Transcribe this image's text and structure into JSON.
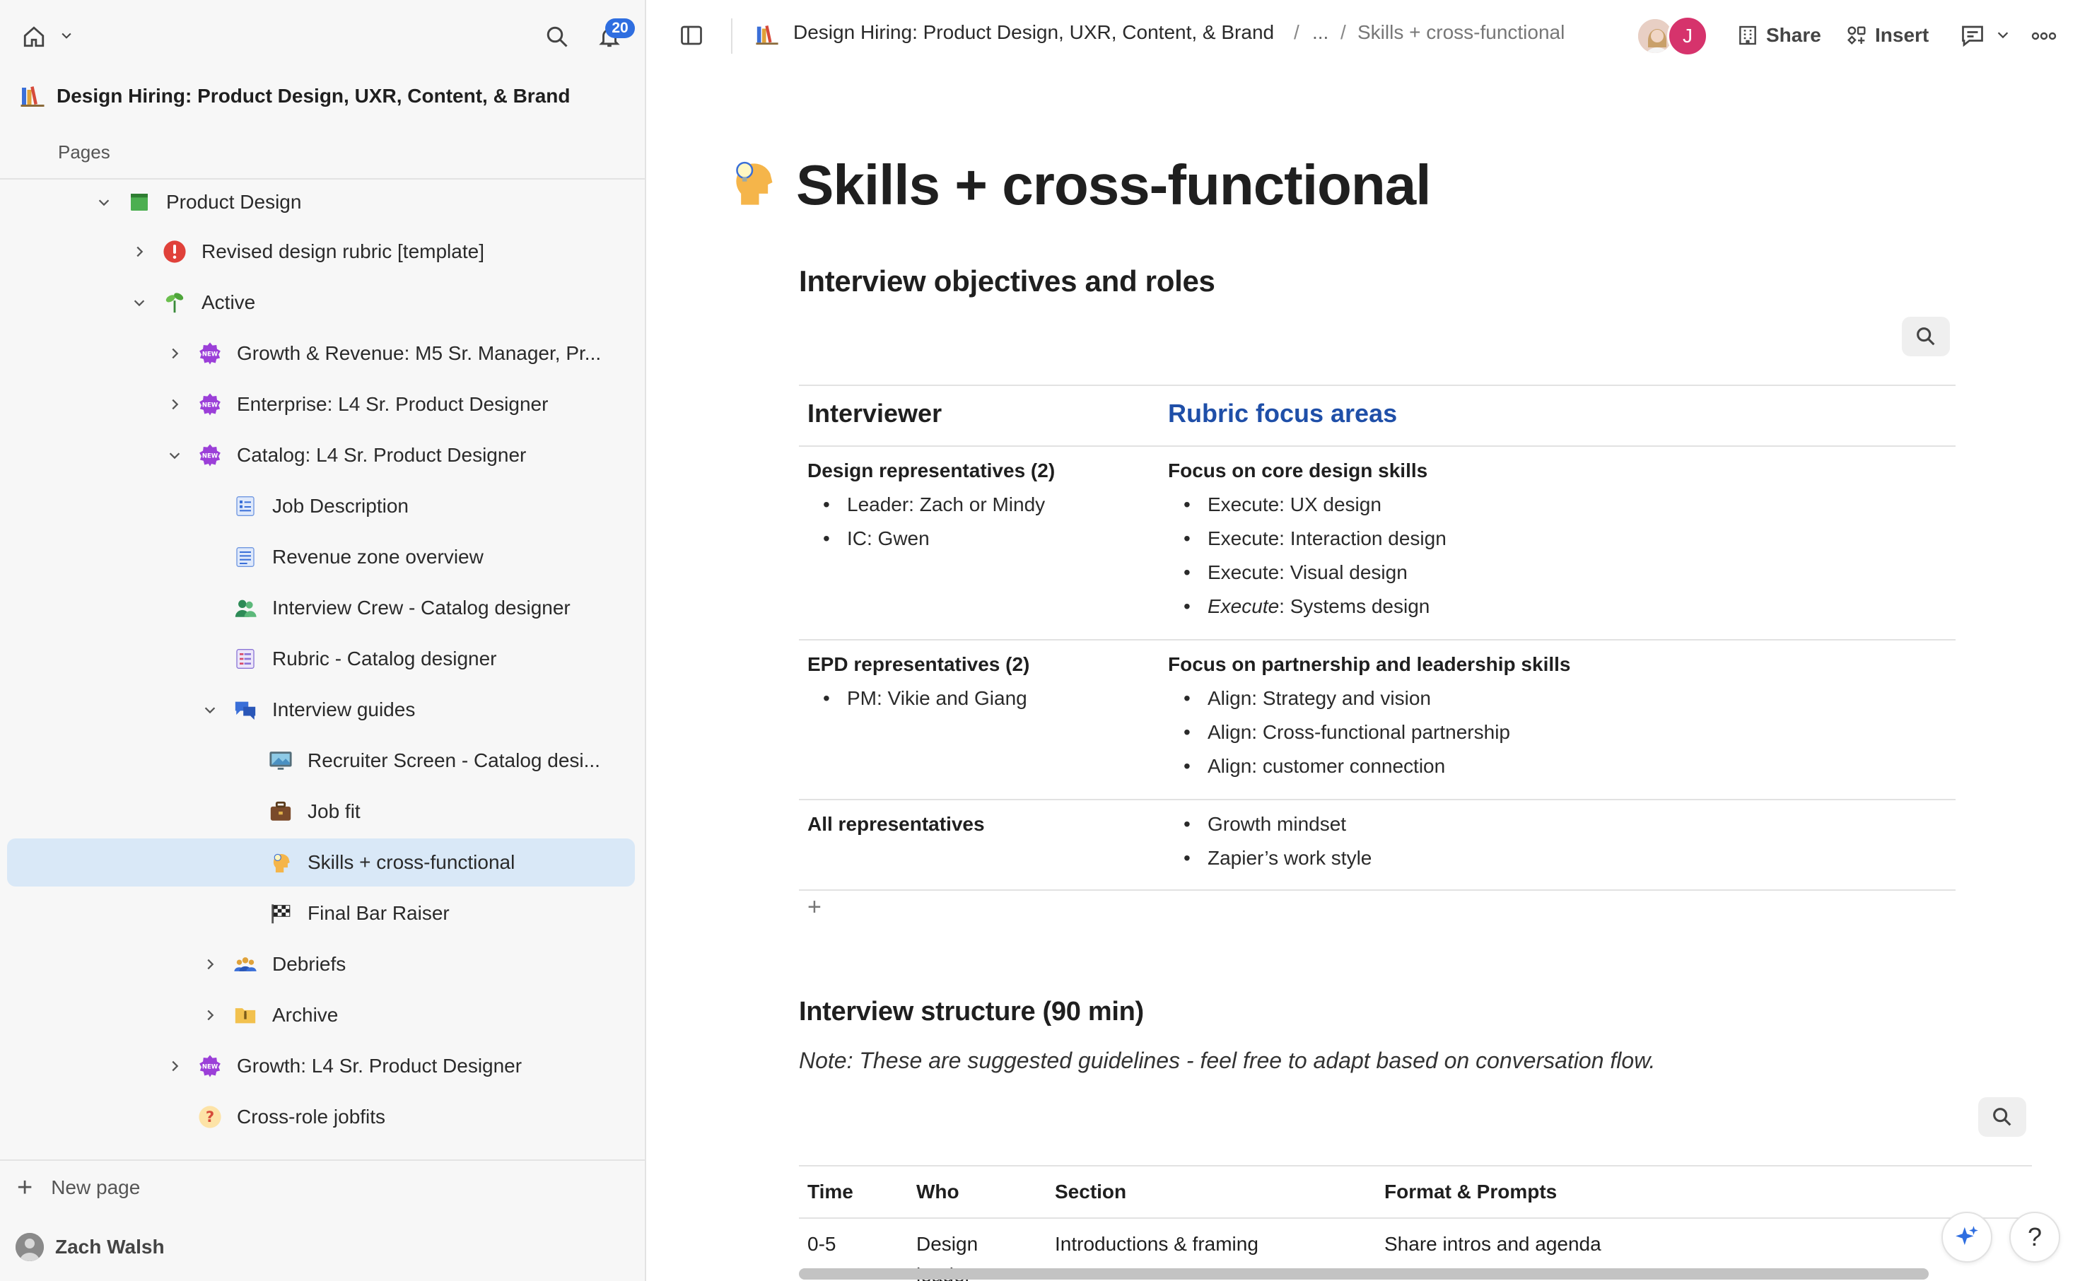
{
  "sidebar": {
    "notifications_count": "20",
    "workspace_title": "Design Hiring: Product Design, UXR, Content, & Brand",
    "pages_label": "Pages",
    "tree": [
      {
        "label": "Product Design",
        "icon": "green-book-icon"
      },
      {
        "label": "Revised design rubric [template]",
        "icon": "exclamation-icon"
      },
      {
        "label": "Active",
        "icon": "plant-icon"
      },
      {
        "label": "Growth & Revenue: M5 Sr. Manager, Pr...",
        "icon": "new-badge-icon"
      },
      {
        "label": "Enterprise: L4 Sr. Product Designer",
        "icon": "new-badge-icon"
      },
      {
        "label": "Catalog: L4 Sr. Product Designer",
        "icon": "new-badge-icon"
      },
      {
        "label": "Job Description",
        "icon": "doc-list-icon"
      },
      {
        "label": "Revenue zone overview",
        "icon": "doc-icon"
      },
      {
        "label": "Interview Crew - Catalog designer",
        "icon": "people-icon"
      },
      {
        "label": "Rubric - Catalog designer",
        "icon": "table-icon"
      },
      {
        "label": "Interview guides",
        "icon": "speech-bubbles-icon"
      },
      {
        "label": "Recruiter Screen - Catalog desi...",
        "icon": "monitor-icon"
      },
      {
        "label": "Job fit",
        "icon": "briefcase-icon"
      },
      {
        "label": "Skills + cross-functional",
        "icon": "head-bulb-icon"
      },
      {
        "label": "Final Bar Raiser",
        "icon": "checkered-flag-icon"
      },
      {
        "label": "Debriefs",
        "icon": "group-icon"
      },
      {
        "label": "Archive",
        "icon": "folder-icon"
      },
      {
        "label": "Growth: L4 Sr. Product Designer",
        "icon": "new-badge-icon"
      },
      {
        "label": "Cross-role jobfits",
        "icon": "question-icon"
      }
    ],
    "new_page": "New page",
    "user_name": "Zach Walsh"
  },
  "topbar": {
    "breadcrumb": {
      "root": "Design Hiring: Product Design, UXR, Content, & Brand",
      "sep1": "/",
      "ellipsis": "...",
      "sep2": "/",
      "current": "Skills + cross-functional"
    },
    "avatar_initial": "J",
    "share": "Share",
    "insert": "Insert"
  },
  "doc": {
    "title": "Skills + cross-functional",
    "section1_heading": "Interview objectives and roles",
    "rubric_table": {
      "col1_header": "Interviewer",
      "col2_header": "Rubric focus areas",
      "rows": [
        {
          "interviewer": "Design representatives (2)",
          "interviewer_items": [
            "Leader: Zach or Mindy",
            "IC: Gwen"
          ],
          "focus_heading": "Focus on core design skills",
          "focus_items": [
            "Execute: UX design",
            "Execute: Interaction design",
            "Execute: Visual design",
            "Execute: Systems design"
          ]
        },
        {
          "interviewer": "EPD representatives (2)",
          "interviewer_items": [
            "PM: Vikie and Giang"
          ],
          "focus_heading": "Focus on partnership and leadership skills",
          "focus_items": [
            "Align: Strategy and vision",
            "Align: Cross-functional partnership",
            "Align: customer connection"
          ]
        },
        {
          "interviewer": "All representatives",
          "interviewer_items": [],
          "focus_heading": "",
          "focus_items": [
            "Growth mindset",
            "Zapier’s work style"
          ]
        }
      ],
      "add_row": "+"
    },
    "section2_heading": "Interview structure (90 min)",
    "note": "Note: These are suggested guidelines - feel free to adapt based on conversation flow.",
    "structure_table": {
      "headers": [
        "Time",
        "Who",
        "Section",
        "Format & Prompts"
      ],
      "rows": [
        [
          "0-5",
          "Design",
          "Introductions & framing",
          "Share intros and agenda"
        ]
      ],
      "partial_text": "leader"
    }
  },
  "colors": {
    "accent_blue": "#1f4fa8",
    "selected_bg": "#d9e8f7",
    "badge_blue": "#2f6ee0",
    "avatar_pink": "#d6336c"
  },
  "help_label": "?"
}
